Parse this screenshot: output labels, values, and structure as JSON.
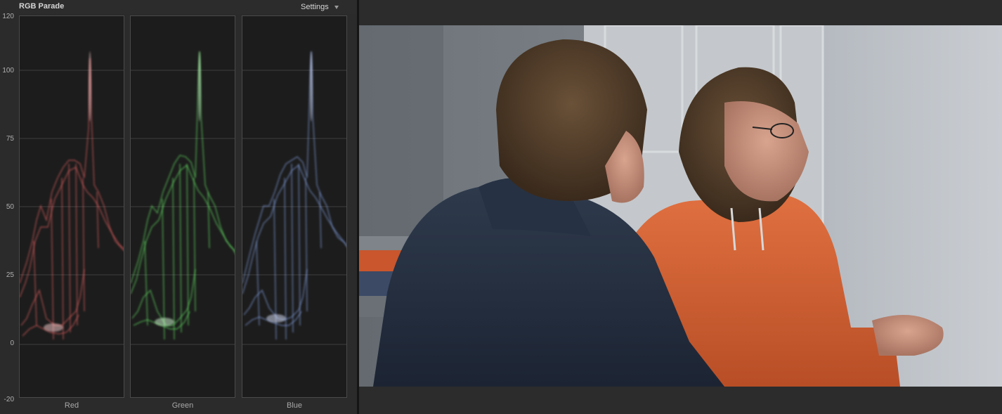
{
  "scope": {
    "title": "RGB Parade",
    "settings_label": "Settings",
    "settings_icon": "chevron-down-icon",
    "y_axis_ticks": [
      "120",
      "100",
      "75",
      "50",
      "25",
      "0",
      "-20"
    ],
    "y_axis_values": [
      120,
      100,
      75,
      50,
      25,
      0,
      -20
    ],
    "channels": [
      {
        "name": "Red",
        "color": "#ff6a6a"
      },
      {
        "name": "Green",
        "color": "#6aff6a"
      },
      {
        "name": "Blue",
        "color": "#8fb0ff"
      }
    ]
  },
  "viewer": {
    "content": "video frame of two people seated in a room"
  }
}
